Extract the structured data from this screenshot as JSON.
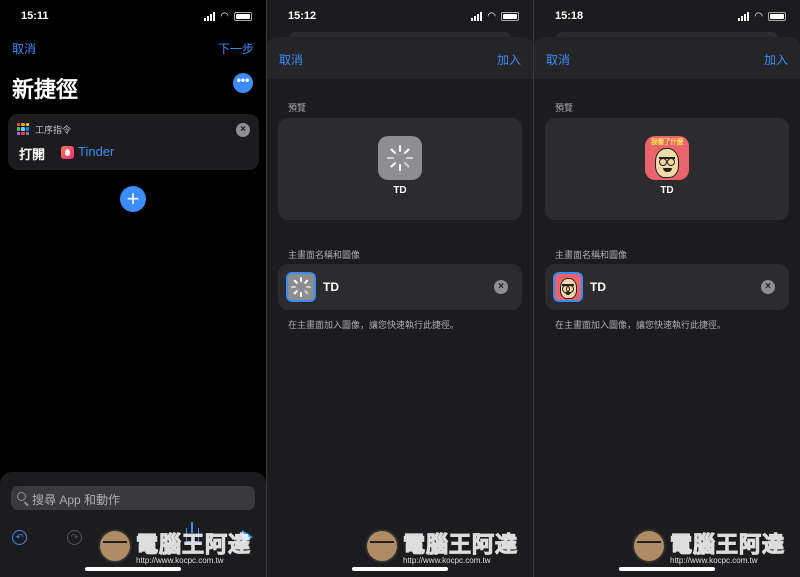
{
  "panels": [
    {
      "status_time": "15:11",
      "nav_cancel": "取消",
      "nav_next": "下一步",
      "title": "新捷徑",
      "more_glyph": "•••",
      "action": {
        "category": "工序指令",
        "verb": "打開",
        "app_name": "Tinder"
      },
      "add_glyph": "+",
      "search_placeholder": "搜尋 App 和動作"
    },
    {
      "status_time": "15:12",
      "nav_cancel": "取消",
      "nav_add": "加入",
      "preview_label": "預覽",
      "preview_name": "TD",
      "home_label": "主畫面名稱和圖像",
      "name_value": "TD",
      "help_text": "在主畫面加入圖像，讓您快速執行此捷徑。",
      "icon_style": "shortcut-default-icon"
    },
    {
      "status_time": "15:18",
      "nav_cancel": "取消",
      "nav_add": "加入",
      "preview_label": "預覽",
      "preview_name": "TD",
      "home_label": "主畫面名稱和圖像",
      "name_value": "TD",
      "help_text": "在主畫面加入圖像，讓您快速執行此捷徑。",
      "icon_banner": "我看了什麼",
      "icon_style": "custom-cartoon-icon"
    }
  ],
  "watermark": {
    "title": "電腦王阿達",
    "url": "http://www.kocpc.com.tw"
  },
  "colors": {
    "accent": "#3b8cf6",
    "background": "#000000",
    "card": "#1c1c1e",
    "tinder": "#fd267a"
  }
}
